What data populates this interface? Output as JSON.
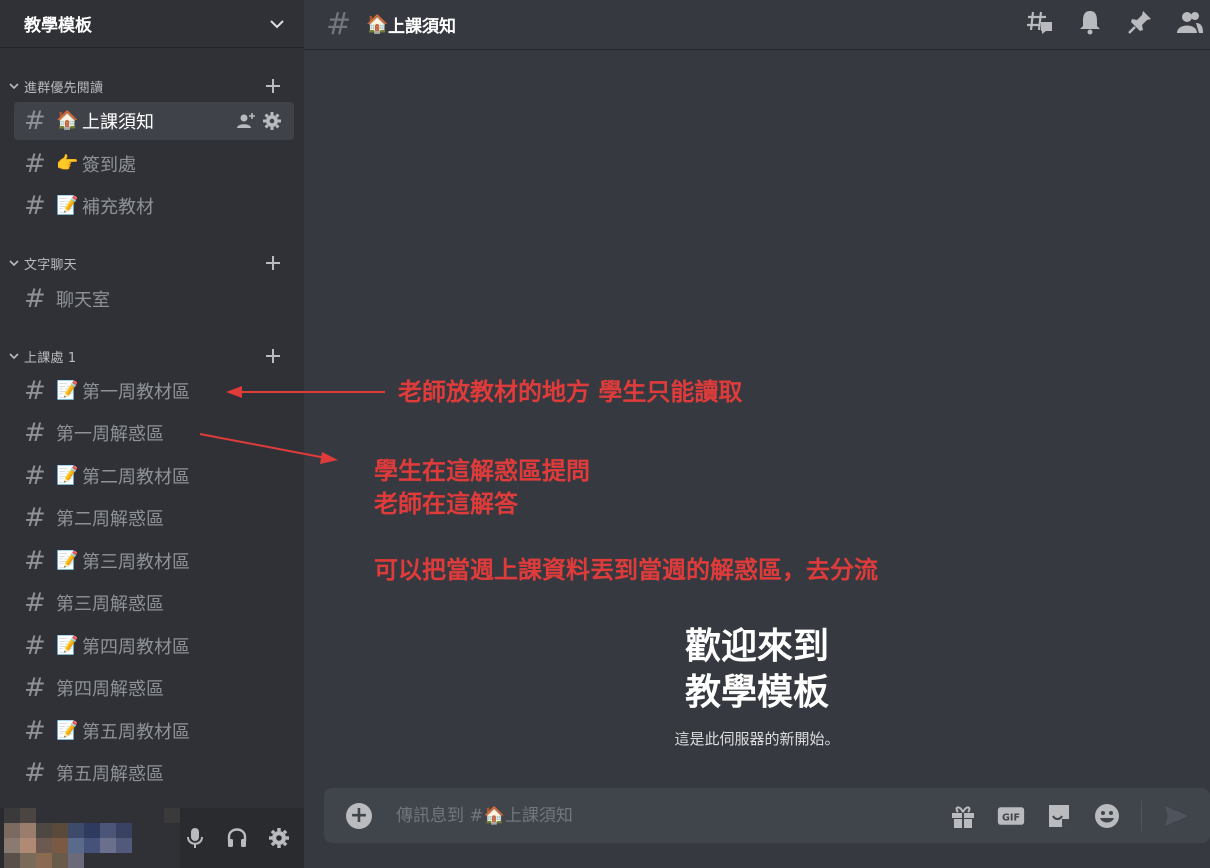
{
  "server": {
    "name": "教學模板"
  },
  "categories": [
    {
      "label": "進群優先閱讀"
    },
    {
      "label": "文字聊天"
    },
    {
      "label": "上課處 1"
    }
  ],
  "channels": [
    {
      "label": "上課須知",
      "emoji": "🏠"
    },
    {
      "label": "簽到處",
      "emoji": "👉"
    },
    {
      "label": "補充教材",
      "emoji": "📝"
    },
    {
      "label": "聊天室",
      "emoji": ""
    },
    {
      "label": "第一周教材區",
      "emoji": "📝"
    },
    {
      "label": "第一周解惑區",
      "emoji": ""
    },
    {
      "label": "第二周教材區",
      "emoji": "📝"
    },
    {
      "label": "第二周解惑區",
      "emoji": ""
    },
    {
      "label": "第三周教材區",
      "emoji": "📝"
    },
    {
      "label": "第三周解惑區",
      "emoji": ""
    },
    {
      "label": "第四周教材區",
      "emoji": "📝"
    },
    {
      "label": "第四周解惑區",
      "emoji": ""
    },
    {
      "label": "第五周教材區",
      "emoji": "📝"
    },
    {
      "label": "第五周解惑區",
      "emoji": ""
    }
  ],
  "topbar": {
    "hash": "#",
    "emoji": "🏠",
    "title": "上課須知"
  },
  "welcome": {
    "line1": "歡迎來到",
    "line2": "教學模板",
    "subtitle": "這是此伺服器的新開始。"
  },
  "composer": {
    "placeholder": "傳訊息到 #🏠上課須知",
    "gif_label": "GIF"
  },
  "annotations": {
    "a1": "老師放教材的地方 學生只能讀取",
    "a2_line1": "學生在這解惑區提問",
    "a2_line2": "老師在這解答",
    "a3": "可以把當週上課資料丟到當週的解惑區，去分流"
  },
  "colors": {
    "sidebar_bg": "#2f3136",
    "main_bg": "#36393f",
    "annotation_red": "#e03b3b",
    "active_channel_bg": "#3f4248"
  }
}
